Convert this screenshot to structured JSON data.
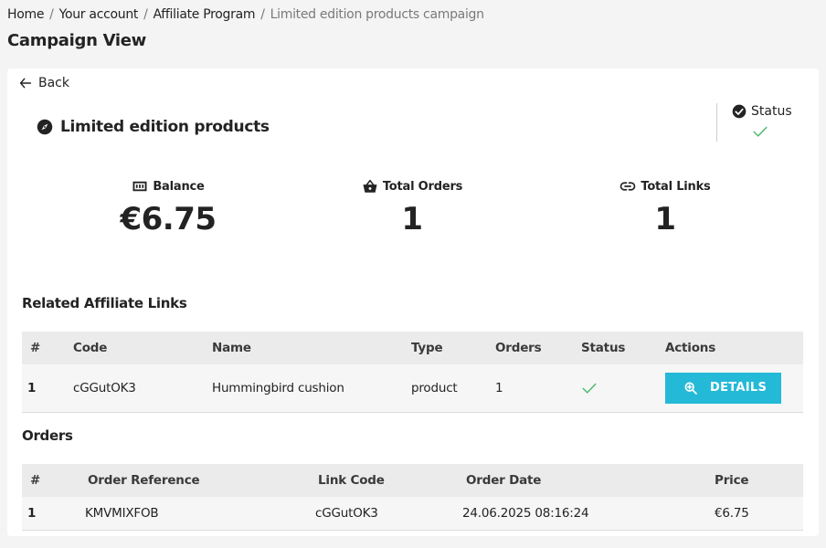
{
  "breadcrumb": {
    "home": "Home",
    "account": "Your account",
    "affiliate": "Affiliate Program",
    "current": "Limited edition products campaign",
    "separator": "/"
  },
  "page_title": "Campaign View",
  "back_label": "Back",
  "campaign": {
    "name": "Limited edition products",
    "icon": "compass-icon"
  },
  "status": {
    "label": "Status",
    "value_icon": "check-icon",
    "active": true
  },
  "stats": {
    "balance": {
      "label": "Balance",
      "value": "€6.75",
      "icon": "cash-icon"
    },
    "total_orders": {
      "label": "Total Orders",
      "value": "1",
      "icon": "basket-icon"
    },
    "total_links": {
      "label": "Total Links",
      "value": "1",
      "icon": "link-icon"
    }
  },
  "links_section": {
    "title": "Related Affiliate Links",
    "columns": [
      "#",
      "Code",
      "Name",
      "Type",
      "Orders",
      "Status",
      "Actions"
    ],
    "rows": [
      {
        "num": "1",
        "code": "cGGutOK3",
        "name": "Hummingbird cushion",
        "type": "product",
        "orders": "1",
        "status": "check",
        "action": "DETAILS"
      }
    ]
  },
  "orders_section": {
    "title": "Orders",
    "columns": [
      "#",
      "Order Reference",
      "Link Code",
      "Order Date",
      "Price"
    ],
    "rows": [
      {
        "num": "1",
        "reference": "KMVMIXFOB",
        "link_code": "cGGutOK3",
        "date": "24.06.2025 08:16:24",
        "price": "€6.75"
      }
    ]
  },
  "colors": {
    "accent": "#24b9d7",
    "success": "#4cbb6c",
    "text": "#232323",
    "muted": "#7a7a7a"
  }
}
